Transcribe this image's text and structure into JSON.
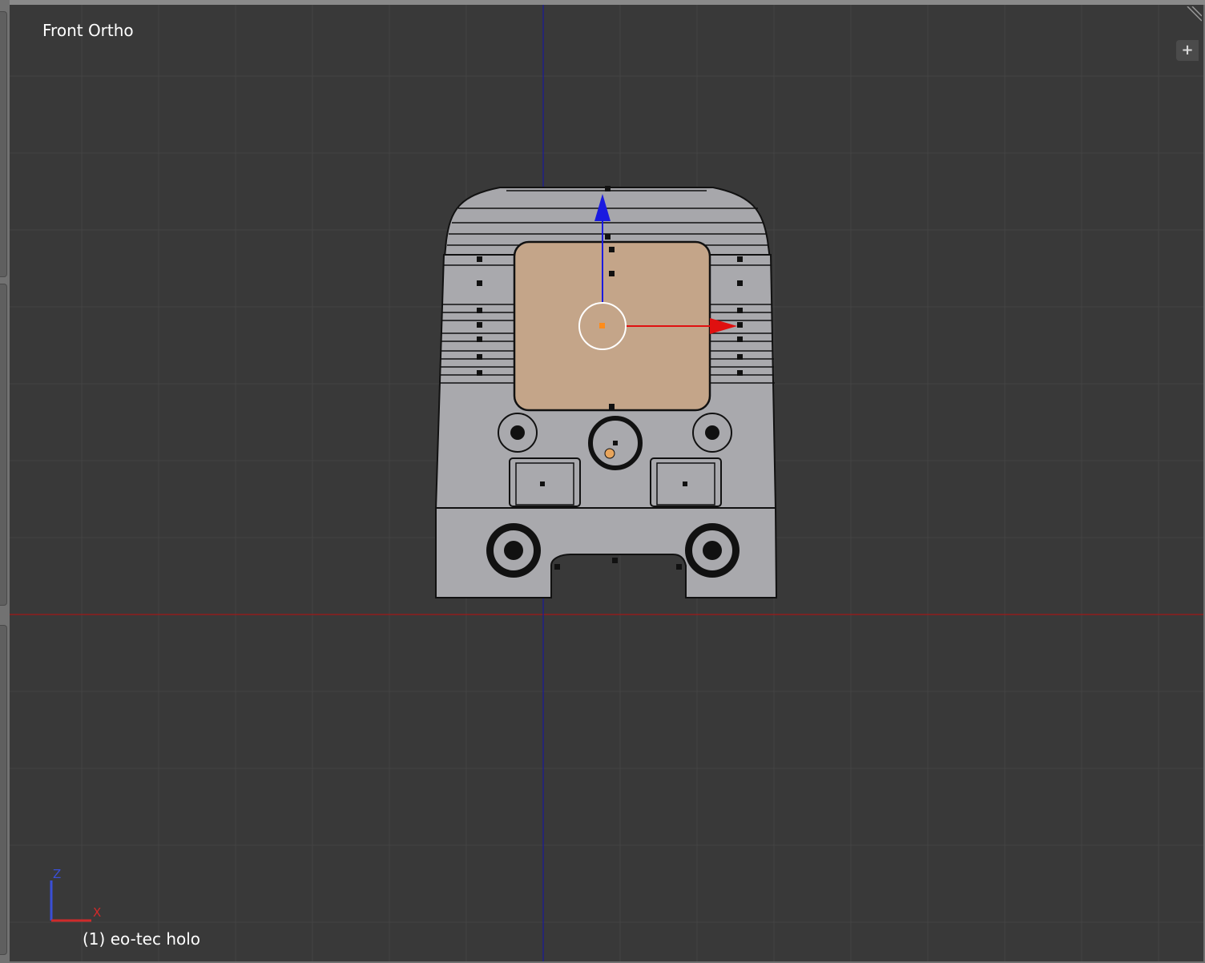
{
  "viewport": {
    "view_title": "Front Ortho",
    "object_label": "(1) eo-tec holo",
    "axis_widget": {
      "z_label": "Z",
      "x_label": "X"
    },
    "add_button_label": "+",
    "colors": {
      "background": "#393939",
      "grid": "#444444",
      "x_axis": "#a01818",
      "z_axis": "#1a1a9a",
      "mesh_face": "#a9a9ad",
      "selected_face": "#c4a589",
      "manipulator_x": "#e01010",
      "manipulator_z": "#1a1ae0",
      "origin": "#ff8c1a"
    }
  },
  "scene": {
    "object_name": "eo-tec holo",
    "mode": "edit-mesh",
    "selected_region": "front-window"
  },
  "icons": {
    "add": "plus-icon",
    "resize": "corner-resize-icon"
  }
}
